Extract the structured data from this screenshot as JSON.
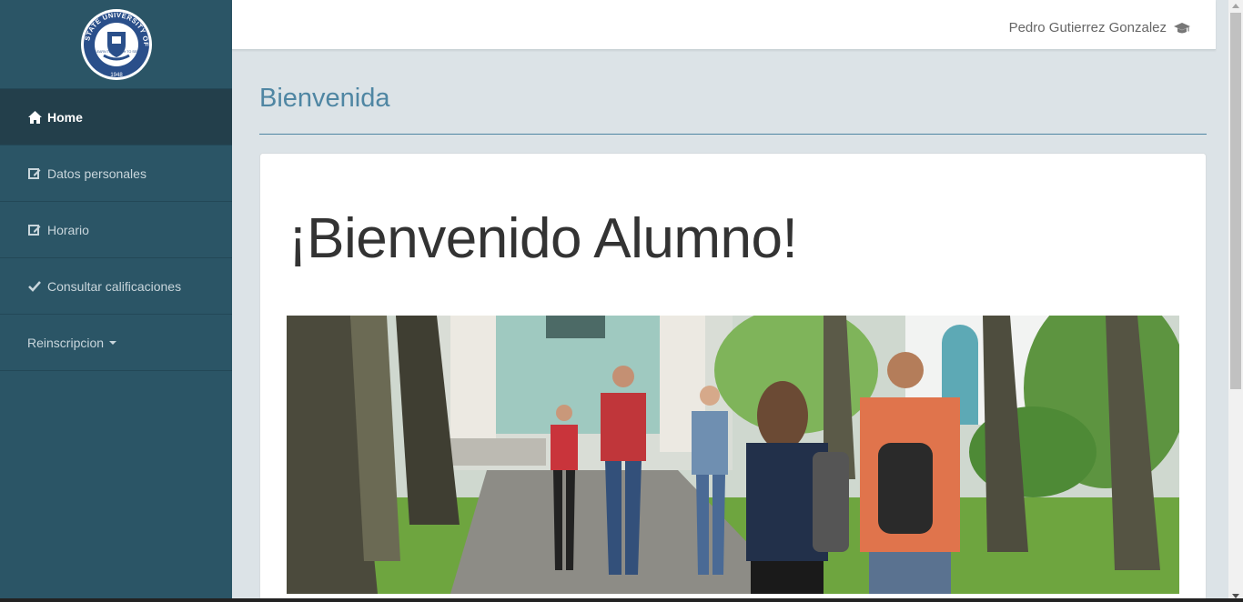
{
  "sidebar": {
    "logo_alt": "State University of New York seal",
    "seal_text": {
      "ring": "STATE UNIVERSITY OF NEW YORK",
      "inner": "TO LEARN TO SEARCH TO SERVE",
      "year": "1948"
    },
    "items": [
      {
        "label": "Home",
        "icon": "home-icon",
        "active": true
      },
      {
        "label": "Datos personales",
        "icon": "edit-icon"
      },
      {
        "label": "Horario",
        "icon": "edit-icon"
      },
      {
        "label": "Consultar calificaciones",
        "icon": "check-icon"
      },
      {
        "label": "Reinscripcion",
        "icon": "caret-down-icon"
      }
    ]
  },
  "header": {
    "user_name": "Pedro Gutierrez Gonzalez",
    "user_icon": "graduation-cap-icon"
  },
  "main": {
    "page_title": "Bienvenida",
    "welcome_heading": "¡Bienvenido Alumno!",
    "hero_image_alt": "Students walking on campus path"
  },
  "colors": {
    "sidebar_bg": "#2b5566",
    "sidebar_active_bg": "#233f4b",
    "accent": "#4f86a3",
    "content_bg": "#dce3e7"
  }
}
